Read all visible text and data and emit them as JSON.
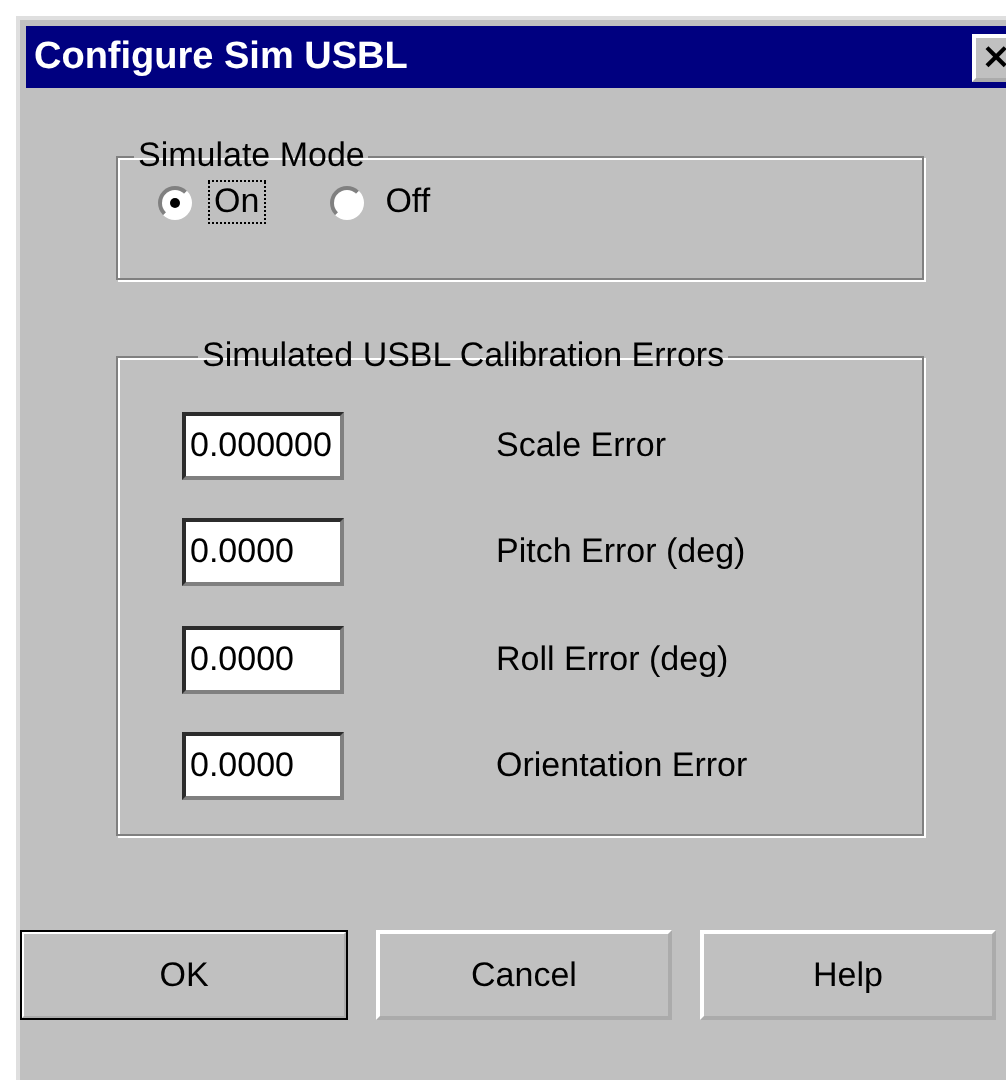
{
  "window": {
    "title": "Configure Sim USBL",
    "close": "×"
  },
  "simulate_mode": {
    "label": "Simulate Mode",
    "options": [
      {
        "label": "On",
        "selected": true,
        "focused": true
      },
      {
        "label": "Off",
        "selected": false,
        "focused": false
      }
    ]
  },
  "calibration_errors": {
    "label": "Simulated USBL Calibration Errors",
    "fields": [
      {
        "value": "0.000000",
        "label": "Scale Error"
      },
      {
        "value": "0.0000",
        "label": "Pitch Error (deg)"
      },
      {
        "value": "0.0000",
        "label": "Roll Error (deg)"
      },
      {
        "value": "0.0000",
        "label": "Orientation Error"
      }
    ]
  },
  "buttons": [
    {
      "label": "OK",
      "default": true
    },
    {
      "label": "Cancel",
      "default": false
    },
    {
      "label": "Help",
      "default": false
    }
  ]
}
